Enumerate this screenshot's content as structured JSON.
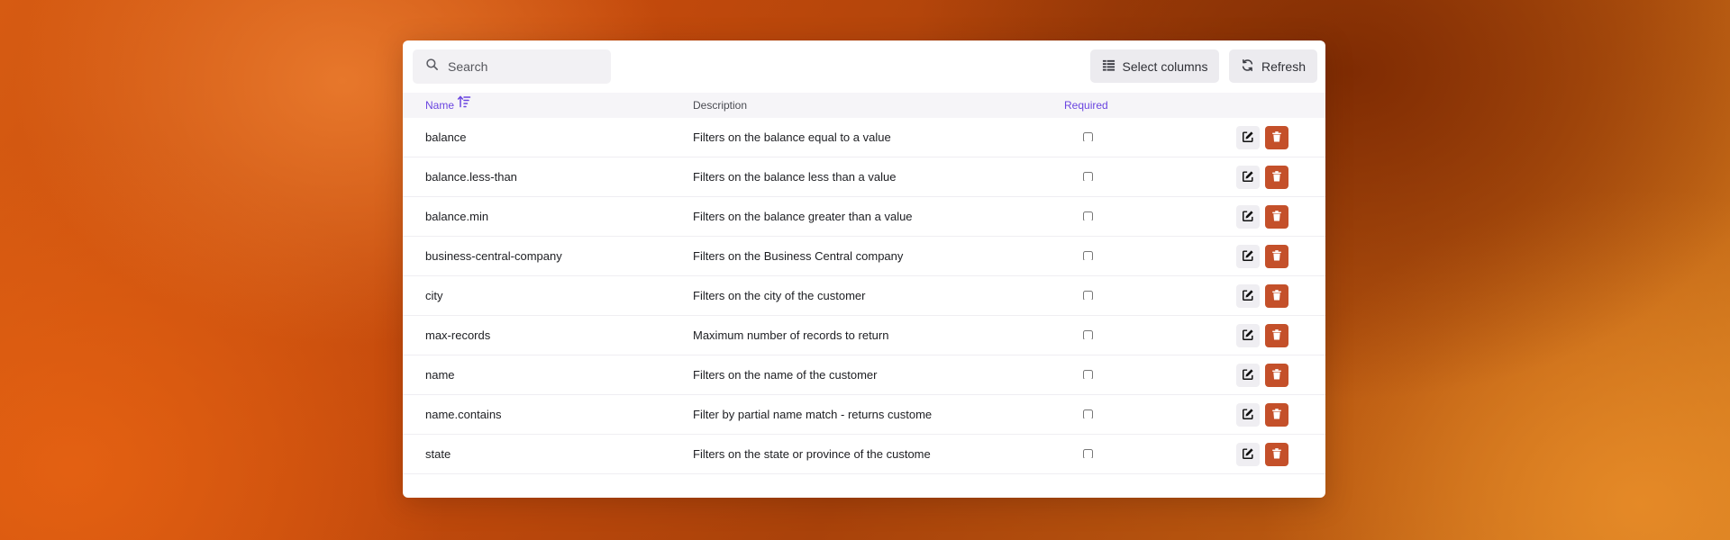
{
  "toolbar": {
    "search_placeholder": "Search",
    "select_columns_label": "Select columns",
    "refresh_label": "Refresh"
  },
  "table": {
    "columns": {
      "name": "Name",
      "description": "Description",
      "required": "Required"
    },
    "sort": {
      "column": "name",
      "icon": "sort-ascending-icon"
    },
    "rows": [
      {
        "name": "balance",
        "description": "Filters on the balance equal to a value",
        "required": false
      },
      {
        "name": "balance.less-than",
        "description": "Filters on the balance less than a value",
        "required": false
      },
      {
        "name": "balance.min",
        "description": "Filters on the balance greater than a value",
        "required": false
      },
      {
        "name": "business-central-company",
        "description": "Filters on the Business Central company",
        "required": false
      },
      {
        "name": "city",
        "description": "Filters on the city of the customer",
        "required": false
      },
      {
        "name": "max-records",
        "description": "Maximum number of records to return",
        "required": false
      },
      {
        "name": "name",
        "description": "Filters on the name of the customer",
        "required": false
      },
      {
        "name": "name.contains",
        "description": "Filter by partial name match - returns custome",
        "required": false
      },
      {
        "name": "state",
        "description": "Filters on the state or province of the custome",
        "required": false
      }
    ]
  },
  "colors": {
    "accent": "#6a45e0",
    "delete": "#c4502a"
  },
  "icons": {
    "search": "search-icon",
    "columns": "columns-icon",
    "refresh": "refresh-icon",
    "edit": "edit-icon",
    "delete": "trash-icon"
  }
}
